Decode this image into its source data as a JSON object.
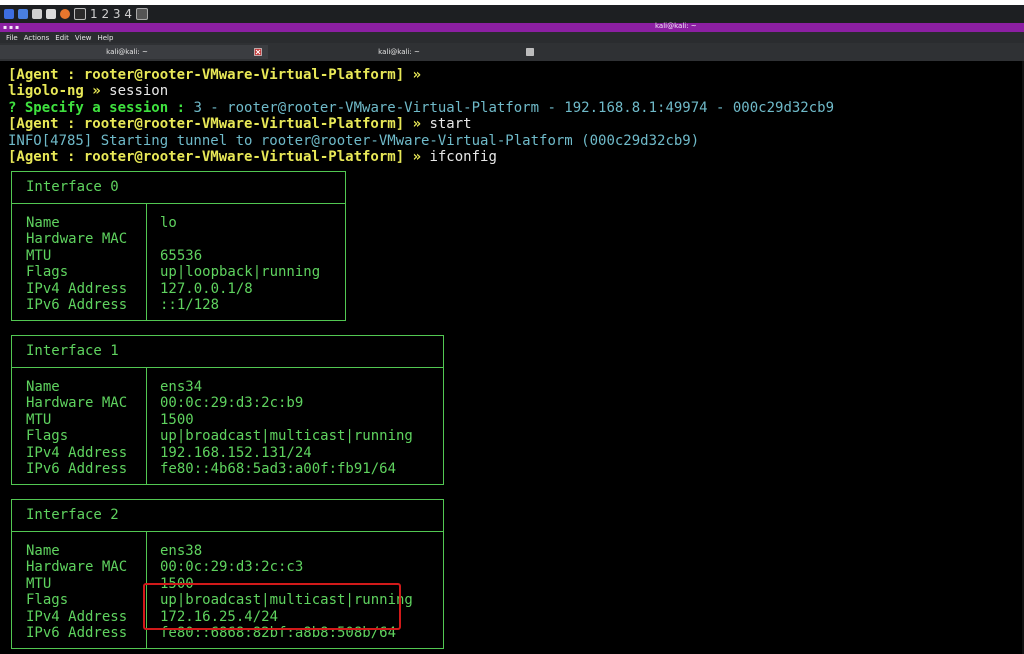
{
  "panel": {
    "workspaces": "1 2 3 4",
    "accent": "#8c1fa3"
  },
  "window": {
    "title": "kali@kali: ~"
  },
  "menu": {
    "items": [
      "File",
      "Actions",
      "Edit",
      "View",
      "Help"
    ]
  },
  "tabs": [
    {
      "label": "kali@kali: ~",
      "active": true
    },
    {
      "label": "kali@kali: ~",
      "active": false
    }
  ],
  "terminal": {
    "lines": [
      {
        "parts": [
          {
            "cls": "yb",
            "text": "[Agent : rooter@rooter-VMware-Virtual-Platform] »"
          }
        ]
      },
      {
        "parts": [
          {
            "cls": "yb",
            "text": "ligolo-ng » "
          },
          {
            "cls": "w",
            "text": "session"
          }
        ]
      },
      {
        "parts": [
          {
            "cls": "gb",
            "text": "? Specify a session : "
          },
          {
            "cls": "cy",
            "text": "3 - rooter@rooter-VMware-Virtual-Platform - 192.168.8.1:49974 - 000c29d32cb9"
          }
        ]
      },
      {
        "parts": [
          {
            "cls": "yb",
            "text": "[Agent : rooter@rooter-VMware-Virtual-Platform] » "
          },
          {
            "cls": "w",
            "text": "start"
          }
        ]
      },
      {
        "parts": [
          {
            "cls": "info",
            "text": "INFO[4785] Starting tunnel to rooter@rooter-VMware-Virtual-Platform (000c29d32cb9)"
          }
        ]
      },
      {
        "parts": [
          {
            "cls": "yb",
            "text": "[Agent : rooter@rooter-VMware-Virtual-Platform] » "
          },
          {
            "cls": "w",
            "text": "ifconfig"
          }
        ]
      }
    ],
    "interfaces": [
      {
        "title": "Interface 0",
        "rows": [
          {
            "key": "Name",
            "value": "lo"
          },
          {
            "key": "Hardware MAC",
            "value": ""
          },
          {
            "key": "MTU",
            "value": "65536"
          },
          {
            "key": "Flags",
            "value": "up|loopback|running"
          },
          {
            "key": "IPv4 Address",
            "value": "127.0.0.1/8"
          },
          {
            "key": "IPv6 Address",
            "value": "::1/128"
          }
        ]
      },
      {
        "title": "Interface 1",
        "rows": [
          {
            "key": "Name",
            "value": "ens34"
          },
          {
            "key": "Hardware MAC",
            "value": "00:0c:29:d3:2c:b9"
          },
          {
            "key": "MTU",
            "value": "1500"
          },
          {
            "key": "Flags",
            "value": "up|broadcast|multicast|running"
          },
          {
            "key": "IPv4 Address",
            "value": "192.168.152.131/24"
          },
          {
            "key": "IPv6 Address",
            "value": "fe80::4b68:5ad3:a00f:fb91/64"
          }
        ]
      },
      {
        "title": "Interface 2",
        "rows": [
          {
            "key": "Name",
            "value": "ens38"
          },
          {
            "key": "Hardware MAC",
            "value": "00:0c:29:d3:2c:c3"
          },
          {
            "key": "MTU",
            "value": "1500"
          },
          {
            "key": "Flags",
            "value": "up|broadcast|multicast|running"
          },
          {
            "key": "IPv4 Address",
            "value": "172.16.25.4/24"
          },
          {
            "key": "IPv6 Address",
            "value": "fe80::6868:82bf:a8b8:508b/64"
          }
        ]
      }
    ],
    "highlight_color": "#d11a1a"
  }
}
